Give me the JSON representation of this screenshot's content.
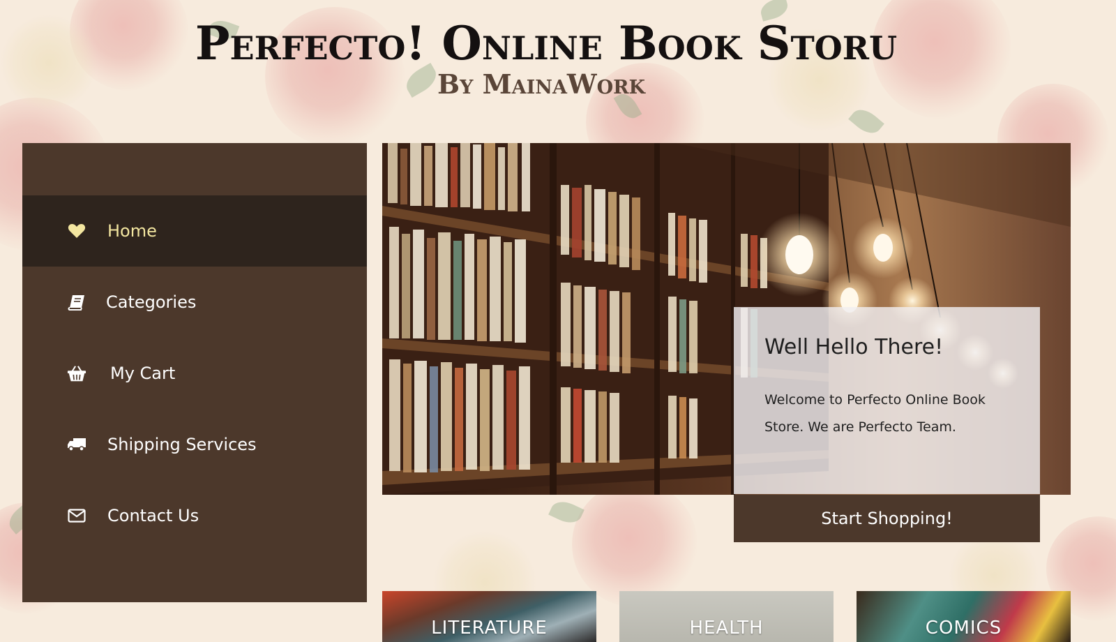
{
  "header": {
    "title": "Perfecto! Online Book Storu",
    "byline": "By MainaWork"
  },
  "sidebar": {
    "items": [
      {
        "label": "Home",
        "icon": "heart-icon",
        "active": true
      },
      {
        "label": "Categories",
        "icon": "book-icon",
        "active": false
      },
      {
        "label": "My Cart",
        "icon": "basket-icon",
        "active": false
      },
      {
        "label": "Shipping Services",
        "icon": "truck-icon",
        "active": false
      },
      {
        "label": "Contact Us",
        "icon": "envelope-icon",
        "active": false
      }
    ]
  },
  "hero": {
    "heading": "Well Hello There!",
    "text": "Welcome to Perfecto Online Book Store. We are Perfecto Team.",
    "cta_label": "Start Shopping!"
  },
  "categories": [
    {
      "label": "LITERATURE"
    },
    {
      "label": "HEALTH"
    },
    {
      "label": "COMICS"
    }
  ],
  "colors": {
    "sidebar_bg": "#4c382b",
    "sidebar_active_bg": "#2e241d",
    "active_accent": "#f3e6a0",
    "page_bg": "#f6eadc"
  }
}
